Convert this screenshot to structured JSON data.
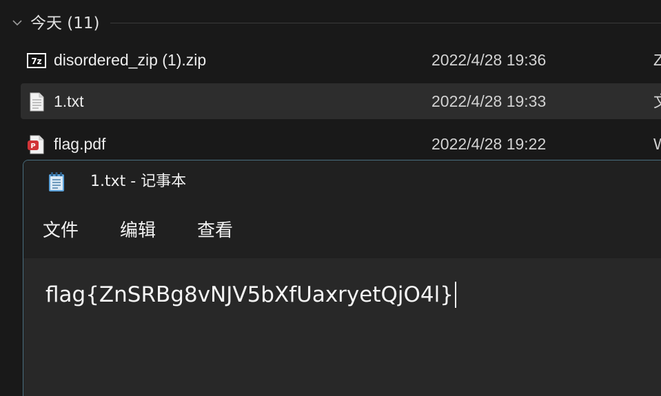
{
  "explorer": {
    "group": {
      "title": "今天 (11)",
      "chevron_icon": "chevron-down-icon"
    },
    "files": [
      {
        "name": "disordered_zip (1).zip",
        "date": "2022/4/28 19:36",
        "type": "Z",
        "icon": "7zip-archive-icon",
        "selected": false
      },
      {
        "name": "1.txt",
        "date": "2022/4/28 19:33",
        "type": "文",
        "icon": "text-document-icon",
        "selected": true
      },
      {
        "name": "flag.pdf",
        "date": "2022/4/28 19:22",
        "type": "W",
        "icon": "pdf-document-icon",
        "selected": false
      }
    ]
  },
  "notepad": {
    "title": "1.txt - 记事本",
    "app_icon": "notepad-icon",
    "menu": {
      "file": "文件",
      "edit": "编辑",
      "view": "查看"
    },
    "content": "flag{ZnSRBg8vNJV5bXfUaxryetQjO4l}"
  },
  "colors": {
    "background": "#191919",
    "selected_row": "#2d2d2d",
    "notepad_frame": "#202020",
    "editor_background": "#282828",
    "window_border": "#4a6f80",
    "pdf_icon": "#d13438"
  }
}
